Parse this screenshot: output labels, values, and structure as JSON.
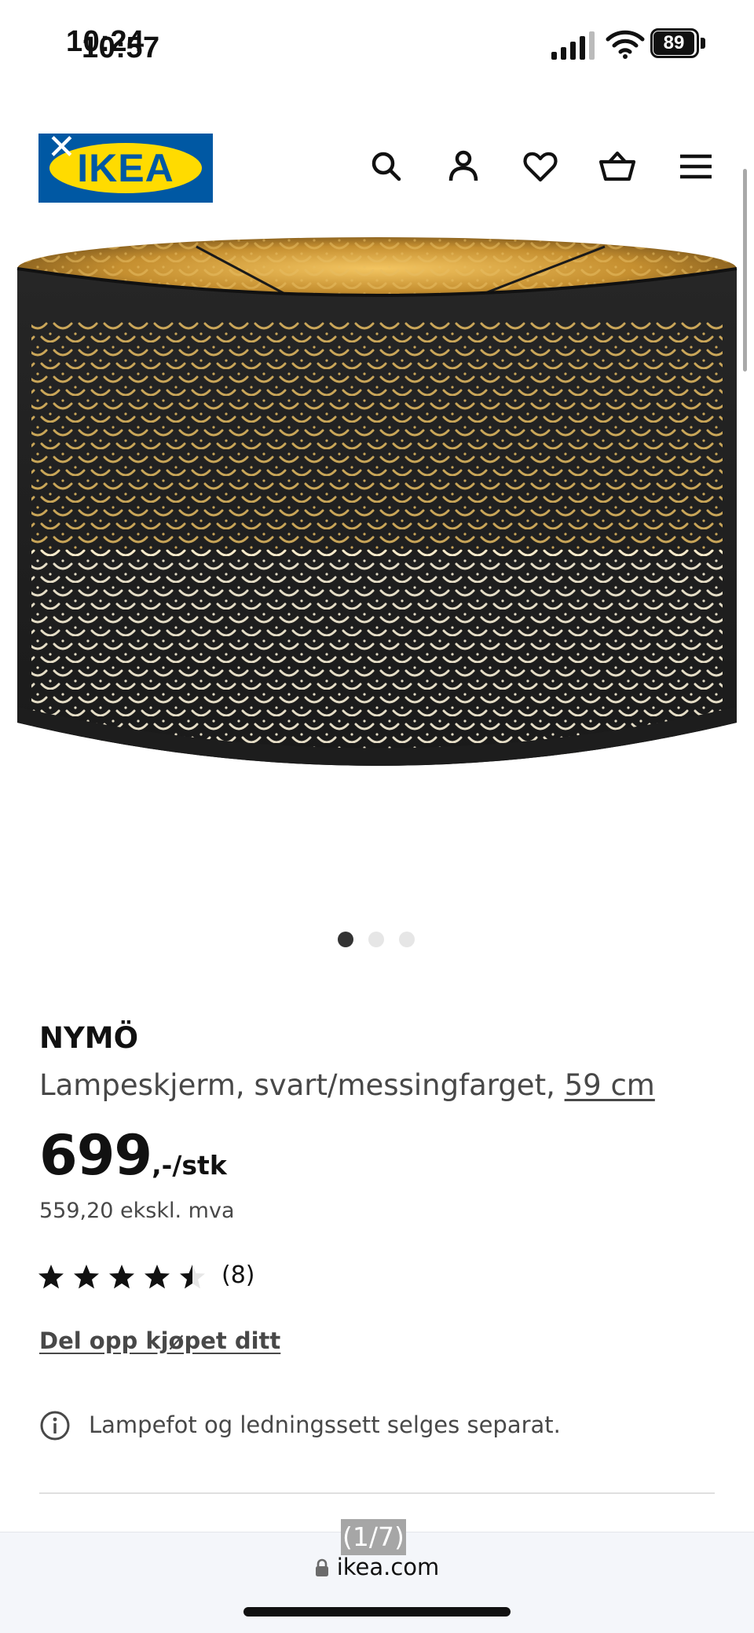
{
  "status_bar": {
    "time_overlay": "10:24",
    "time": "10:57",
    "battery": "89"
  },
  "header": {
    "logo_text": "IKEA",
    "icons": [
      "close-icon",
      "search-icon",
      "account-icon",
      "heart-icon",
      "basket-icon",
      "menu-icon"
    ]
  },
  "gallery": {
    "current": 1,
    "total": 3
  },
  "product": {
    "name": "NYMÖ",
    "description": "Lampeskjerm, svart/messingfarget, ",
    "size": "59 cm",
    "price": "699",
    "price_suffix": ",-/stk",
    "price_ex_vat": "559,20 ekskl. mva",
    "rating": 4.5,
    "rating_max": 5,
    "review_count": "(8)",
    "split_payment_link": "Del opp kjøpet ditt",
    "info_text": "Lampefot og ledningssett selges separat."
  },
  "browser": {
    "page_counter": "(1/7)",
    "url": "ikea.com"
  },
  "colors": {
    "ikea_blue": "#0058a3",
    "ikea_yellow": "#ffdb00",
    "text_primary": "#111111",
    "text_secondary": "#484848"
  }
}
